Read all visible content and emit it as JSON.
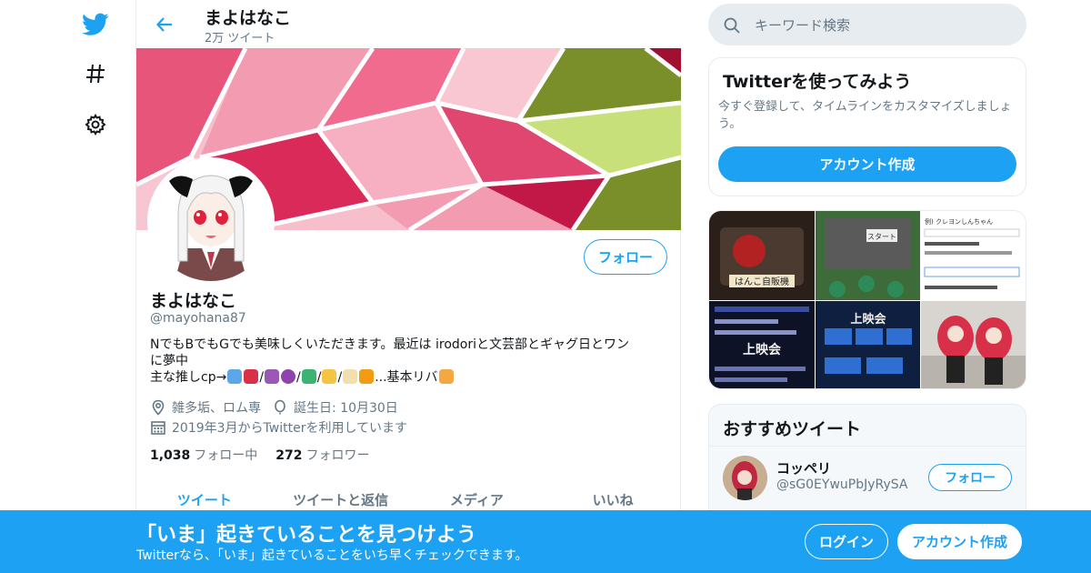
{
  "colors": {
    "accent": "#1da1f2",
    "secondary_text": "#657786",
    "border": "#e6ecf0"
  },
  "nav": {
    "items": [
      {
        "icon": "twitter-bird-icon"
      },
      {
        "icon": "hashtag-icon"
      },
      {
        "icon": "gear-icon"
      }
    ]
  },
  "header": {
    "name": "まよはなこ",
    "tweet_count": "2万 ツイート"
  },
  "profile": {
    "follow_label": "フォロー",
    "name": "まよはなこ",
    "handle": "@mayohana87",
    "bio_line1": "NでもBでもGでも美味しくいただきます。最近は irodoriと文芸部とギャグ日とワン",
    "bio_line2": "に夢中",
    "bio_line3_prefix": "主な推しcp→",
    "bio_slash": "/",
    "bio_line3_suffix": "...基本リバ",
    "location": "雑多垢、ロム専",
    "birthday": "誕生日: 10月30日",
    "joined": "2019年3月からTwitterを利用しています",
    "following_count": "1,038",
    "following_label": "フォロー中",
    "followers_count": "272",
    "followers_label": "フォロワー"
  },
  "tabs": [
    {
      "label": "ツイート",
      "active": true
    },
    {
      "label": "ツイートと返信",
      "active": false
    },
    {
      "label": "メディア",
      "active": false
    },
    {
      "label": "いいね",
      "active": false
    }
  ],
  "search": {
    "placeholder": "キーワード検索"
  },
  "try_card": {
    "title": "Twitterを使ってみよう",
    "text": "今すぐ登録して、タイムラインをカスタマイズしましょう。",
    "signup_label": "アカウント作成"
  },
  "media_thumbs": [
    {
      "caption": "はんこ自販機"
    },
    {
      "caption": "スタート"
    },
    {
      "caption": "例) クレヨンしんちゃん"
    },
    {
      "caption": "上映会"
    },
    {
      "caption": "上映会"
    },
    {
      "caption": ""
    }
  ],
  "recommend": {
    "title": "おすすめツイート",
    "name": "コッペリ",
    "handle": "@sG0EYwuPbJyRySA",
    "follow_label": "フォロー"
  },
  "bottom_bar": {
    "title": "「いま」起きていることを見つけよう",
    "subtitle": "Twitterなら、「いま」起きていることをいち早くチェックできます。",
    "login_label": "ログイン",
    "signup_label": "アカウント作成"
  }
}
